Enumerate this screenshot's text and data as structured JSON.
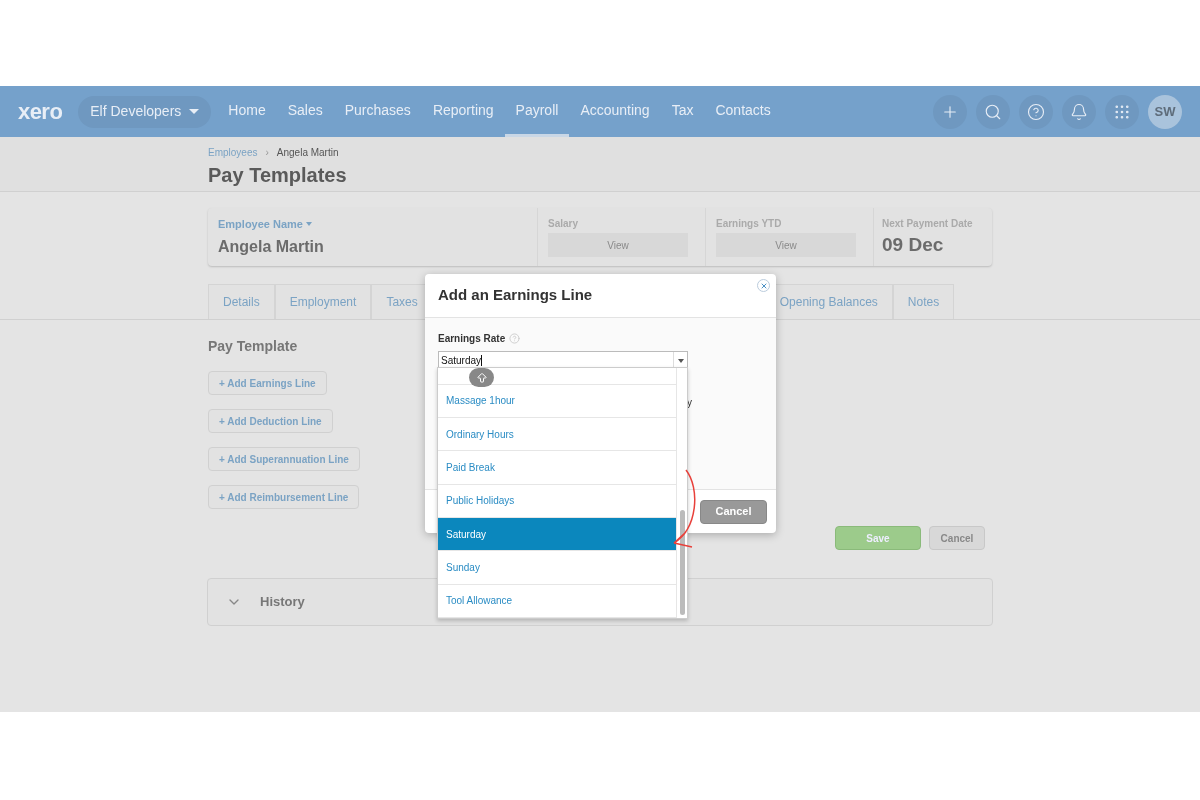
{
  "nav": {
    "logo": "xero",
    "org": "Elf Developers",
    "items": [
      {
        "label": "Home",
        "selected": false
      },
      {
        "label": "Sales",
        "selected": false
      },
      {
        "label": "Purchases",
        "selected": false
      },
      {
        "label": "Reporting",
        "selected": false
      },
      {
        "label": "Payroll",
        "selected": true
      },
      {
        "label": "Accounting",
        "selected": false
      },
      {
        "label": "Tax",
        "selected": false
      },
      {
        "label": "Contacts",
        "selected": false
      }
    ],
    "avatar": "SW"
  },
  "breadcrumb": {
    "link": "Employees",
    "separator": "›",
    "current": "Angela Martin"
  },
  "page_title": "Pay Templates",
  "summary": {
    "employee_label": "Employee Name",
    "employee_name": "Angela Martin",
    "salary_label": "Salary",
    "salary_button": "View",
    "ytd_label": "Earnings YTD",
    "ytd_button": "View",
    "next_label": "Next Payment Date",
    "next_value": "09 Dec"
  },
  "tabs": [
    {
      "label": "Details",
      "selected": false
    },
    {
      "label": "Employment",
      "selected": false
    },
    {
      "label": "Taxes",
      "selected": false
    },
    {
      "label": "Opening Balances",
      "selected": false
    },
    {
      "label": "Notes",
      "selected": false
    }
  ],
  "pay_template": {
    "title": "Pay Template",
    "buttons": [
      "+ Add Earnings Line",
      "+ Add Deduction Line",
      "+ Add Superannuation Line",
      "+ Add Reimbursement Line"
    ],
    "save": "Save",
    "cancel": "Cancel"
  },
  "history": {
    "title": "History",
    "expanded": false
  },
  "modal": {
    "title": "Add an Earnings Line",
    "field_label": "Earnings Rate",
    "field_value": "Saturday",
    "hidden_text": "y",
    "cancel": "Cancel",
    "options": [
      {
        "label": "Massage 1hour",
        "selected": false
      },
      {
        "label": "Ordinary Hours",
        "selected": false
      },
      {
        "label": "Paid Break",
        "selected": false
      },
      {
        "label": "Public Holidays",
        "selected": false
      },
      {
        "label": "Saturday",
        "selected": true
      },
      {
        "label": "Sunday",
        "selected": false
      },
      {
        "label": "Tool Allowance",
        "selected": false
      }
    ]
  }
}
